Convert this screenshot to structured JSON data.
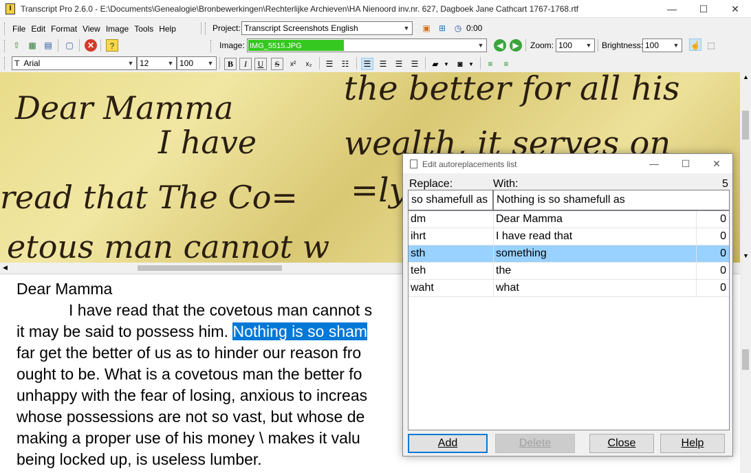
{
  "window": {
    "title": "Transcript Pro 2.6.0 - E:\\Documents\\Genealogie\\Bronbewerkingen\\Rechterlijke Archieven\\HA Nienoord inv.nr. 627, Dagboek Jane Cathcart 1767-1768.rtf",
    "minimize": "—",
    "maximize": "☐",
    "close": "✕"
  },
  "menu": [
    "File",
    "Edit",
    "Format",
    "View",
    "Image",
    "Tools",
    "Help"
  ],
  "project": {
    "label": "Project:",
    "value": "Transcript Screenshots English",
    "timer": "0:00"
  },
  "image_bar": {
    "label": "Image:",
    "value": "IMG_5515.JPG",
    "zoom_label": "Zoom:",
    "zoom_value": "100",
    "brightness_label": "Brightness:",
    "brightness_value": "100",
    "load_progress": 0.4
  },
  "format_bar": {
    "font": "Arial",
    "size": "12",
    "zoom": "100"
  },
  "format_buttons": {
    "bold": "B",
    "italic": "I",
    "underline": "U",
    "strike": "S",
    "superscript": "x²",
    "subscript": "x₂"
  },
  "image_text": {
    "line1a": "Dear Mamma",
    "line1b": "the better for all his",
    "line2a": "I have",
    "line2b": "wealth, it serves on",
    "line3a": "read that The Co=",
    "line3b": "=ly",
    "line4a": "etous man cannot w"
  },
  "document": {
    "line1": "Dear Mamma",
    "line2": "I have read that the covetous man cannot s",
    "line3_pre": "it may be said to possess him. ",
    "line3_sel": "Nothing is so sham",
    "line4": "far get the better of us as to hinder our reason fro",
    "line5": "ought to be. What is a covetous man the better fo",
    "line6": "unhappy with the fear of losing, anxious to increas",
    "line7": "whose possessions are not so vast, but whose de",
    "line8": "making a proper use of his money \\ makes it valu",
    "line9": "being locked up, is useless lumber."
  },
  "dialog": {
    "title": "Edit autoreplacements list",
    "replace_label": "Replace:",
    "with_label": "With:",
    "count": "5",
    "replace_value": "so shamefull as",
    "with_value": "Nothing is so shamefull as",
    "rows": [
      {
        "replace": "dm",
        "with": "Dear Mamma",
        "n": "0"
      },
      {
        "replace": "ihrt",
        "with": "I have read that",
        "n": "0"
      },
      {
        "replace": "sth",
        "with": "something",
        "n": "0"
      },
      {
        "replace": "teh",
        "with": "the",
        "n": "0"
      },
      {
        "replace": "waht",
        "with": "what",
        "n": "0"
      }
    ],
    "selected_row": 2,
    "buttons": {
      "add": "Add",
      "delete": "Delete",
      "close": "Close",
      "help": "Help"
    }
  },
  "icons": [
    "app-icon",
    "open-folder-icon",
    "open-image-icon",
    "save-icon",
    "preview-icon",
    "stop-icon",
    "help-icon",
    "project-new-icon",
    "project-window-icon",
    "clock-icon",
    "back-arrow-icon",
    "forward-arrow-icon",
    "hand-icon",
    "select-icon"
  ]
}
